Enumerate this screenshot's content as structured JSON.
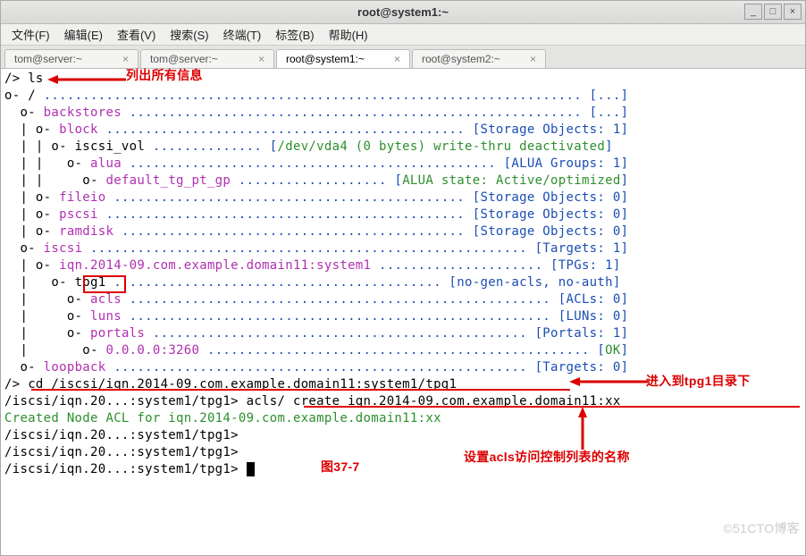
{
  "window": {
    "title": "root@system1:~"
  },
  "win_btns": {
    "min": "_",
    "max": "□",
    "close": "×"
  },
  "menus": [
    "文件(F)",
    "编辑(E)",
    "查看(V)",
    "搜索(S)",
    "终端(T)",
    "标签(B)",
    "帮助(H)"
  ],
  "tabs": [
    {
      "label": "tom@server:~",
      "active": false
    },
    {
      "label": "tom@server:~",
      "active": false
    },
    {
      "label": "root@system1:~",
      "active": true
    },
    {
      "label": "root@system2:~",
      "active": false
    }
  ],
  "term": {
    "l1a": "/> ",
    "l1b": "ls",
    "l2a": "o- ",
    "l2b": "/",
    "l2c": " ..................................................................... [...]",
    "l3a": "  o- ",
    "l3b": "backstores",
    "l3c": " .......................................................... [...]",
    "l4a": "  | o- ",
    "l4b": "block",
    "l4c": " .............................................. [Storage Objects: 1]",
    "l5a": "  | | o- ",
    "l5b": "iscsi_vol",
    "l5c": " .............. [",
    "l5d": "/dev/vda4 (0 bytes) write-thru deactivated",
    "l5e": "]",
    "l6a": "  | |   o- ",
    "l6b": "alua",
    "l6c": " ............................................... [ALUA Groups: 1]",
    "l7a": "  | |     o- ",
    "l7b": "default_tg_pt_gp",
    "l7c": " ................... [",
    "l7d": "ALUA state: Active/optimized",
    "l7e": "]",
    "l8a": "  | o- ",
    "l8b": "fileio",
    "l8c": " ............................................. [Storage Objects: 0]",
    "l9a": "  | o- ",
    "l9b": "pscsi",
    "l9c": " .............................................. [Storage Objects: 0]",
    "l10a": "  | o- ",
    "l10b": "ramdisk",
    "l10c": " ............................................ [Storage Objects: 0]",
    "l11a": "  o- ",
    "l11b": "iscsi",
    "l11c": " ........................................................ [Targets: 1]",
    "l12a": "  | o- ",
    "l12b": "iqn.2014-09.com.example.domain11:system1",
    "l12c": " ..................... [TPGs: 1]",
    "l13a": "  |   o- ",
    "l13b": "tpg1",
    "l13c": " .......................................... [no-gen-acls, no-auth]",
    "l14a": "  |     o- ",
    "l14b": "acls",
    "l14c": " ...................................................... [ACLs: 0]",
    "l15a": "  |     o- ",
    "l15b": "luns",
    "l15c": " ...................................................... [LUNs: 0]",
    "l16a": "  |     o- ",
    "l16b": "portals",
    "l16c": " ................................................ [Portals: 1]",
    "l17a": "  |       o- ",
    "l17b": "0.0.0.0:3260",
    "l17c": " ................................................. [",
    "l17d": "OK",
    "l17e": "]",
    "l18a": "  o- ",
    "l18b": "loopback",
    "l18c": " ..................................................... [Targets: 0]",
    "l19a": "/> ",
    "l19b": "cd /iscsi/iqn.2014-09.com.example.domain11:system1/tpg1",
    "l20": "/iscsi/iqn.20...:system1/tpg1> acls/ create iqn.2014-09.com.example.domain11:xx",
    "l21": "Created Node ACL for iqn.2014-09.com.example.domain11:xx",
    "l22": "/iscsi/iqn.20...:system1/tpg1>",
    "l23": "/iscsi/iqn.20...:system1/tpg1>",
    "l24": "/iscsi/iqn.20...:system1/tpg1> "
  },
  "annotations": {
    "a1": "列出所有信息",
    "a2": "进入到tpg1目录下",
    "a3": "设置acls访问控制列表的名称",
    "a4": "图37-7"
  },
  "watermark": "©51CTO博客"
}
